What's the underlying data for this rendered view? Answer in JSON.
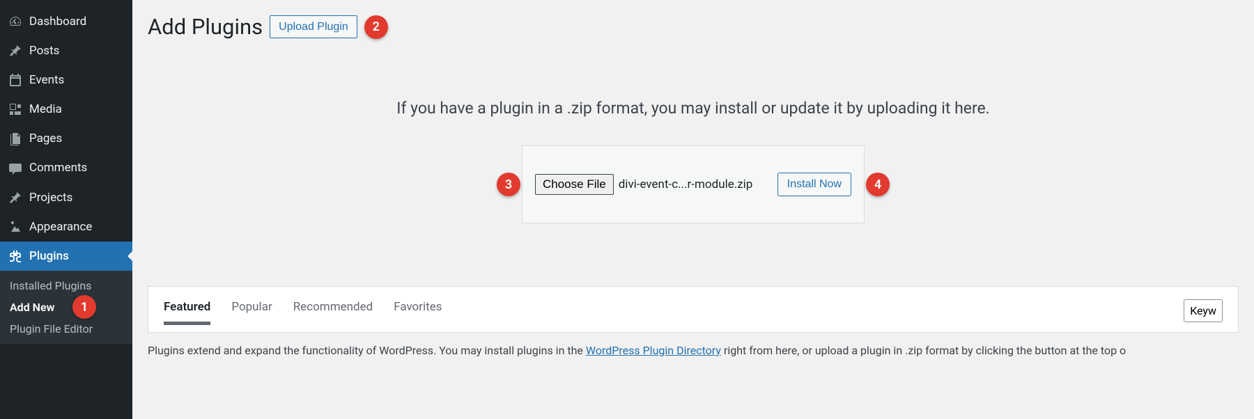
{
  "sidebar": {
    "items": [
      {
        "label": "Dashboard",
        "icon": "dashboard"
      },
      {
        "label": "Posts",
        "icon": "pin"
      },
      {
        "label": "Events",
        "icon": "calendar"
      },
      {
        "label": "Media",
        "icon": "media"
      },
      {
        "label": "Pages",
        "icon": "pages"
      },
      {
        "label": "Comments",
        "icon": "comments"
      },
      {
        "label": "Projects",
        "icon": "pin"
      },
      {
        "label": "Appearance",
        "icon": "appearance"
      },
      {
        "label": "Plugins",
        "icon": "plugins"
      }
    ],
    "submenu": [
      {
        "label": "Installed Plugins"
      },
      {
        "label": "Add New"
      },
      {
        "label": "Plugin File Editor"
      }
    ]
  },
  "header": {
    "title": "Add Plugins",
    "upload_button": "Upload Plugin"
  },
  "upload": {
    "hint": "If you have a plugin in a .zip format, you may install or update it by uploading it here.",
    "choose_file": "Choose File",
    "file_name": "divi-event-c...r-module.zip",
    "install_button": "Install Now"
  },
  "tabs": {
    "items": [
      "Featured",
      "Popular",
      "Recommended",
      "Favorites"
    ],
    "search_select": "Keyw"
  },
  "description": {
    "prefix": "Plugins extend and expand the functionality of WordPress. You may install plugins in the ",
    "link": "WordPress Plugin Directory",
    "suffix": " right from here, or upload a plugin in .zip format by clicking the button at the top o"
  },
  "badges": {
    "b1": "1",
    "b2": "2",
    "b3": "3",
    "b4": "4"
  }
}
